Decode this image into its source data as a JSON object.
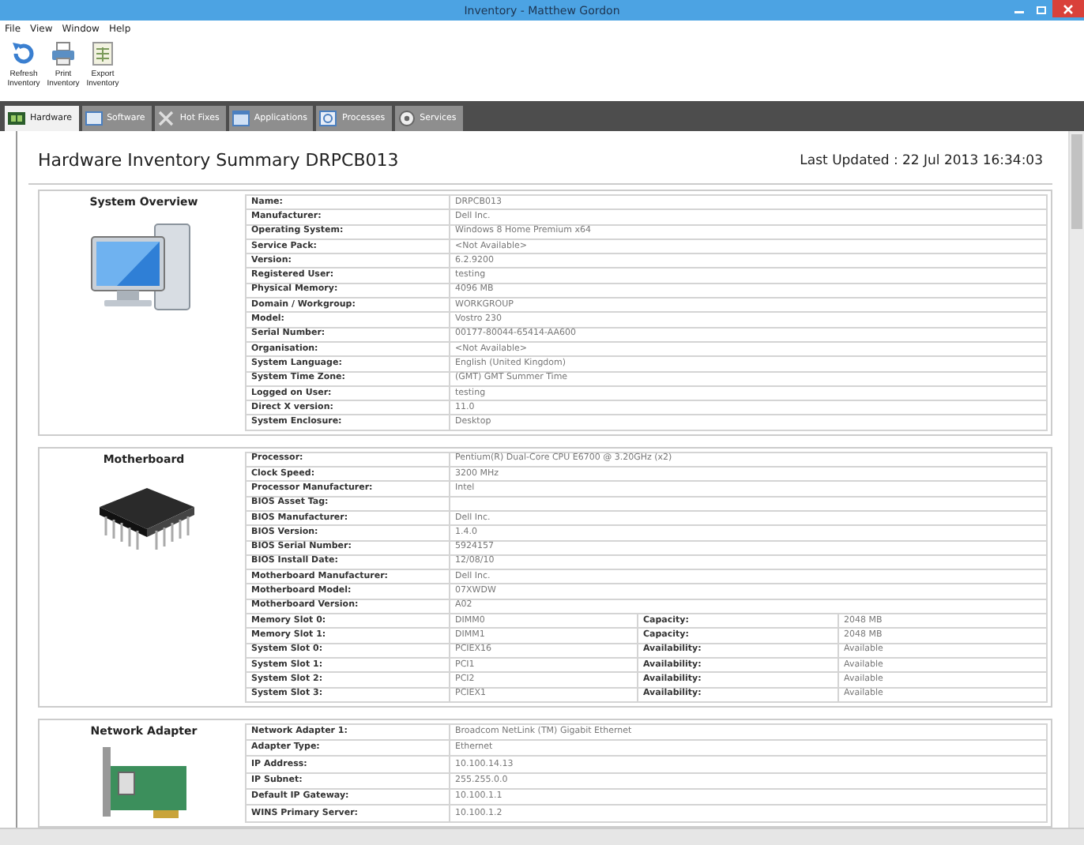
{
  "window": {
    "title": "Inventory - Matthew Gordon"
  },
  "menu": [
    "File",
    "View",
    "Window",
    "Help"
  ],
  "toolbar": [
    {
      "label": "Refresh Inventory",
      "kind": "refresh"
    },
    {
      "label": "Print Inventory",
      "kind": "print"
    },
    {
      "label": "Export Inventory",
      "kind": "export"
    }
  ],
  "tabs": [
    {
      "label": "Hardware",
      "kind": "hardware",
      "selected": true
    },
    {
      "label": "Software",
      "kind": "software",
      "selected": false
    },
    {
      "label": "Hot Fixes",
      "kind": "hotfix",
      "selected": false
    },
    {
      "label": "Applications",
      "kind": "applications",
      "selected": false
    },
    {
      "label": "Processes",
      "kind": "processes",
      "selected": false
    },
    {
      "label": "Services",
      "kind": "services",
      "selected": false
    }
  ],
  "heading": "Hardware Inventory Summary DRPCB013",
  "last_updated": "Last Updated : 22 Jul 2013 16:34:03",
  "sections": [
    {
      "title": "System Overview",
      "kind": "computer",
      "rows": [
        {
          "label": "Name:",
          "value": "DRPCB013"
        },
        {
          "label": "Manufacturer:",
          "value": "Dell Inc."
        },
        {
          "label": "Operating System:",
          "value": "Windows 8 Home Premium x64"
        },
        {
          "label": "Service Pack:",
          "value": "<Not Available>"
        },
        {
          "label": "Version:",
          "value": "6.2.9200"
        },
        {
          "label": "Registered User:",
          "value": "testing"
        },
        {
          "label": "Physical Memory:",
          "value": "4096 MB"
        },
        {
          "label": "Domain / Workgroup:",
          "value": "WORKGROUP"
        },
        {
          "label": "Model:",
          "value": "Vostro 230"
        },
        {
          "label": "Serial Number:",
          "value": "00177-80044-65414-AA600"
        },
        {
          "label": "Organisation:",
          "value": "<Not Available>"
        },
        {
          "label": "System Language:",
          "value": "English (United Kingdom)"
        },
        {
          "label": "System Time Zone:",
          "value": "(GMT) GMT Summer Time"
        },
        {
          "label": "Logged on User:",
          "value": "testing"
        },
        {
          "label": "Direct X version:",
          "value": "11.0"
        },
        {
          "label": "System Enclosure:",
          "value": "Desktop"
        }
      ]
    },
    {
      "title": "Motherboard",
      "kind": "chip",
      "rows": [
        {
          "label": "Processor:",
          "value": "Pentium(R) Dual-Core CPU E6700 @ 3.20GHz (x2)"
        },
        {
          "label": "Clock Speed:",
          "value": "3200 MHz"
        },
        {
          "label": "Processor Manufacturer:",
          "value": "Intel"
        },
        {
          "label": "BIOS Asset Tag:"
        },
        {
          "label": "BIOS Manufacturer:",
          "value": "Dell Inc."
        },
        {
          "label": "BIOS Version:",
          "value": "1.4.0"
        },
        {
          "label": "BIOS Serial Number:",
          "value": "5924157"
        },
        {
          "label": "BIOS Install Date:",
          "value": "12/08/10"
        },
        {
          "label": "Motherboard Manufacturer:",
          "value": "Dell Inc."
        },
        {
          "label": "Motherboard Model:",
          "value": "07XWDW"
        },
        {
          "label": "Motherboard Version:",
          "value": "A02"
        },
        {
          "label": "Memory Slot 0:",
          "value": "DIMM0",
          "label_2": "Capacity:",
          "value_2": "2048 MB"
        },
        {
          "label": "Memory Slot 1:",
          "value": "DIMM1",
          "label_2": "Capacity:",
          "value_2": "2048 MB"
        },
        {
          "label": "System Slot 0:",
          "value": "PCIEX16",
          "label_2": "Availability:",
          "value_2": "Available"
        },
        {
          "label": "System Slot 1:",
          "value": "PCI1",
          "label_2": "Availability:",
          "value_2": "Available"
        },
        {
          "label": "System Slot 2:",
          "value": "PCI2",
          "label_2": "Availability:",
          "value_2": "Available"
        },
        {
          "label": "System Slot 3:",
          "value": "PCIEX1",
          "label_2": "Availability:",
          "value_2": "Available"
        }
      ]
    },
    {
      "title": "Network Adapter",
      "kind": "card",
      "rows": [
        {
          "label": "Network Adapter 1:",
          "value": "Broadcom NetLink (TM) Gigabit Ethernet"
        },
        {
          "label": "Adapter Type:",
          "value": "Ethernet"
        },
        {
          "label": "IP Address:",
          "value": "10.100.14.13"
        },
        {
          "label": "IP Subnet:",
          "value": "255.255.0.0"
        },
        {
          "label": "Default IP Gateway:",
          "value": "10.100.1.1"
        },
        {
          "label": "WINS Primary Server:",
          "value": "10.100.1.2"
        }
      ]
    }
  ]
}
